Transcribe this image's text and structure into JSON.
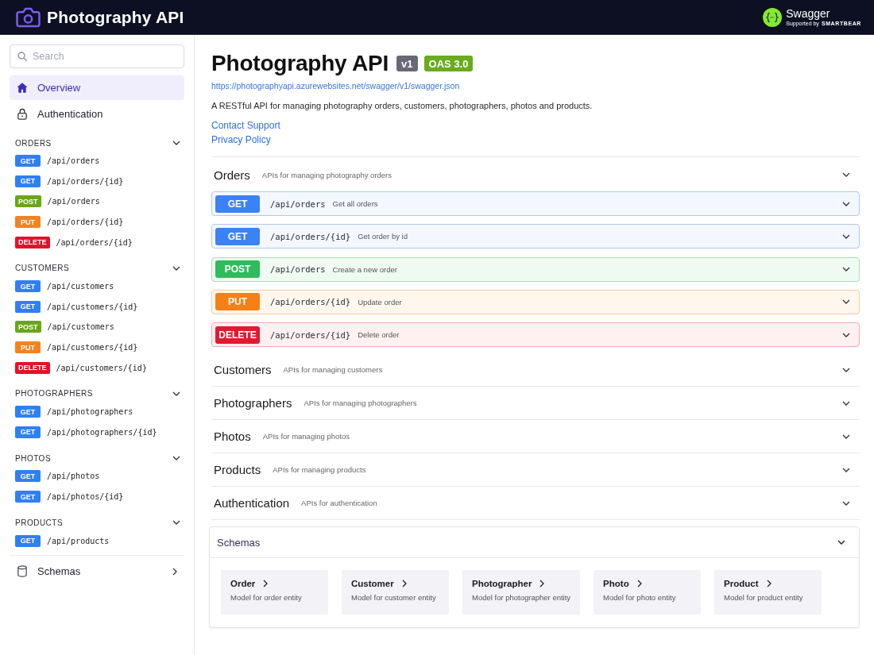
{
  "header": {
    "title": "Photography API",
    "brand": {
      "name": "Swagger",
      "tagline": "Supported by",
      "company": "SMARTBEAR"
    }
  },
  "sidebar": {
    "search": {
      "placeholder": "Search"
    },
    "nav": [
      {
        "label": "Overview",
        "selected": true
      },
      {
        "label": "Authentication",
        "selected": false
      }
    ],
    "groups": [
      {
        "title": "ORDERS",
        "expanded": true,
        "endpoints": [
          {
            "method": "GET",
            "kind": "get",
            "path": "/api/orders"
          },
          {
            "method": "GET",
            "kind": "get",
            "path": "/api/orders/{id}"
          },
          {
            "method": "POST",
            "kind": "post",
            "path": "/api/orders"
          },
          {
            "method": "PUT",
            "kind": "put",
            "path": "/api/orders/{id}"
          },
          {
            "method": "DELETE",
            "kind": "delete",
            "path": "/api/orders/{id}"
          }
        ]
      },
      {
        "title": "CUSTOMERS",
        "expanded": true,
        "endpoints": [
          {
            "method": "GET",
            "kind": "get",
            "path": "/api/customers"
          },
          {
            "method": "GET",
            "kind": "get",
            "path": "/api/customers/{id}"
          },
          {
            "method": "POST",
            "kind": "post",
            "path": "/api/customers"
          },
          {
            "method": "PUT",
            "kind": "put",
            "path": "/api/customers/{id}"
          },
          {
            "method": "DELETE",
            "kind": "delete",
            "path": "/api/customers/{id}"
          }
        ]
      },
      {
        "title": "PHOTOGRAPHERS",
        "expanded": true,
        "endpoints": [
          {
            "method": "GET",
            "kind": "get",
            "path": "/api/photographers"
          },
          {
            "method": "GET",
            "kind": "get",
            "path": "/api/photographers/{id}"
          }
        ]
      },
      {
        "title": "PHOTOS",
        "expanded": true,
        "endpoints": [
          {
            "method": "GET",
            "kind": "get",
            "path": "/api/photos"
          },
          {
            "method": "GET",
            "kind": "get",
            "path": "/api/photos/{id}"
          }
        ]
      },
      {
        "title": "PRODUCTS",
        "expanded": true,
        "endpoints": [
          {
            "method": "GET",
            "kind": "get",
            "path": "/api/products"
          }
        ]
      }
    ],
    "schemas_link": {
      "label": "Schemas",
      "expanded": false
    }
  },
  "main": {
    "title": "Photography API",
    "badges": [
      {
        "text": "v1",
        "color": "#686878"
      },
      {
        "text": "OAS 3.0",
        "color": "#6aab1f"
      }
    ],
    "url": "https://photographyapi.azurewebsites.net/swagger/v1/swagger.json",
    "description": "A RESTful API for managing photography orders, customers, photographers, photos and products.",
    "links": [
      "Contact Support",
      "Privacy Policy"
    ],
    "sections": [
      {
        "name": "Orders",
        "description": "APIs for managing photography orders",
        "operations": [
          {
            "method": "GET",
            "kind": "get",
            "path": "/api/orders",
            "summary": "Get all orders"
          },
          {
            "method": "GET",
            "kind": "get",
            "path": "/api/orders/{id}",
            "summary": "Get order by id"
          },
          {
            "method": "POST",
            "kind": "post",
            "path": "/api/orders",
            "summary": "Create a new order"
          },
          {
            "method": "PUT",
            "kind": "put",
            "path": "/api/orders/{id}",
            "summary": "Update order"
          },
          {
            "method": "DELETE",
            "kind": "delete",
            "path": "/api/orders/{id}",
            "summary": "Delete order"
          }
        ]
      },
      {
        "name": "Customers",
        "description": "APIs for managing customers"
      },
      {
        "name": "Photographers",
        "description": "APIs for managing photographers"
      },
      {
        "name": "Photos",
        "description": "APIs for managing photos"
      },
      {
        "name": "Products",
        "description": "APIs for managing products"
      },
      {
        "name": "Authentication",
        "description": "APIs for authentication"
      }
    ],
    "schemas": {
      "title": "Schemas",
      "expanded": true,
      "models": [
        {
          "name": "Order",
          "description": "Model for order entity"
        },
        {
          "name": "Customer",
          "description": "Model for customer entity"
        },
        {
          "name": "Photographer",
          "description": "Model for photographer entity"
        },
        {
          "name": "Photo",
          "description": "Model for photo entity"
        },
        {
          "name": "Product",
          "description": "Model for product entity"
        }
      ]
    }
  }
}
